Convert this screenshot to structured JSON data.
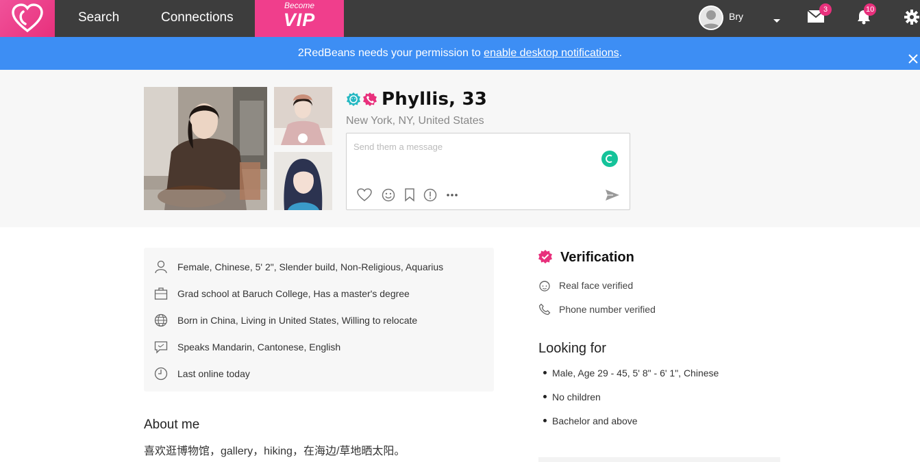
{
  "nav": {
    "links": [
      "Search",
      "Connections"
    ],
    "vip_top": "Become",
    "vip_main": "VIP",
    "username": "Bry",
    "messages_count": "3",
    "notifications_count": "10"
  },
  "notification_bar": {
    "prefix": "2RedBeans needs your permission to ",
    "link": "enable desktop notifications",
    "suffix": "."
  },
  "profile": {
    "name": "Phyllis, 33",
    "location": "New York, NY, United States",
    "message_placeholder": "Send them a message"
  },
  "info": [
    {
      "icon": "person-icon",
      "text": "Female, Chinese, 5' 2\", Slender build, Non-Religious, Aquarius"
    },
    {
      "icon": "briefcase-icon",
      "text": "Grad school at Baruch College, Has a master's degree"
    },
    {
      "icon": "globe-icon",
      "text": "Born in China, Living in United States, Willing to relocate"
    },
    {
      "icon": "chat-icon",
      "text": "Speaks Mandarin, Cantonese, English"
    },
    {
      "icon": "clock-icon",
      "text": "Last online today"
    }
  ],
  "about": {
    "title": "About me",
    "text": "喜欢逛博物馆，gallery，hiking，在海边/草地晒太阳。"
  },
  "verification": {
    "title": "Verification",
    "items": [
      "Real face verified",
      "Phone number verified"
    ]
  },
  "looking_for": {
    "title": "Looking for",
    "items": [
      "Male, Age 29 - 45, 5' 8\" - 6' 1\", Chinese",
      "No children",
      "Bachelor and above"
    ]
  },
  "colors": {
    "brand_pink": "#e8307c",
    "nav_bg": "#3d3d3d",
    "notif_blue": "#3d8ef4",
    "verify_teal": "#25b8c2"
  }
}
